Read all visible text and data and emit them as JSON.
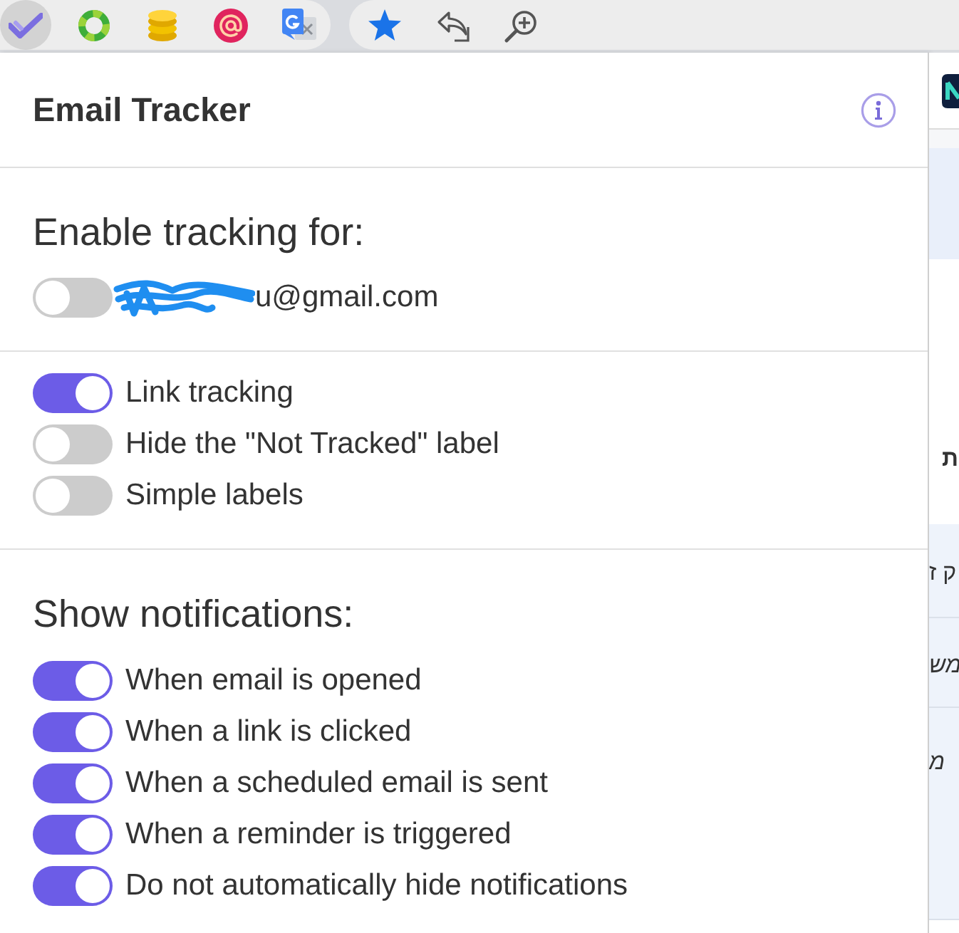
{
  "toolbar": {
    "extensions": [
      {
        "selected": true
      },
      {
        "selected": false
      },
      {
        "selected": false
      },
      {
        "selected": false
      },
      {
        "selected": false
      }
    ]
  },
  "popup": {
    "title": "Email Tracker",
    "account_section": {
      "heading": "Enable tracking for:",
      "accounts": [
        {
          "email": "u@gmail.com",
          "on": false
        }
      ]
    },
    "options": [
      {
        "label": "Link tracking",
        "on": true
      },
      {
        "label": "Hide the \"Not Tracked\" label",
        "on": false
      },
      {
        "label": "Simple labels",
        "on": false
      }
    ],
    "notifications": {
      "heading": "Show notifications:",
      "items": [
        {
          "label": "When email is opened",
          "on": true
        },
        {
          "label": "When a link is clicked",
          "on": true
        },
        {
          "label": "When a scheduled email is sent",
          "on": true
        },
        {
          "label": "When a reminder is triggered",
          "on": true
        },
        {
          "label": "Do not automatically hide notifications",
          "on": true
        }
      ]
    }
  },
  "background_page": {
    "texts": [
      "ת",
      "ק ז",
      "מש",
      "מ"
    ]
  }
}
